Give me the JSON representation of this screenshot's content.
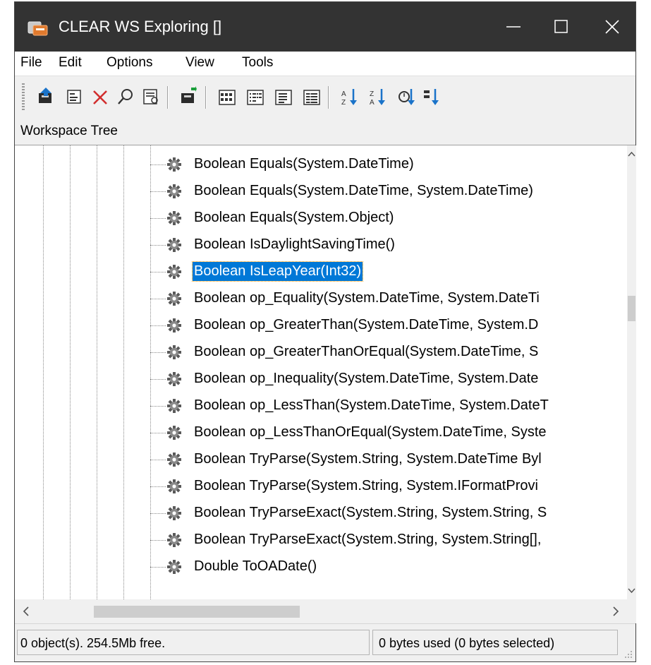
{
  "window": {
    "title": "CLEAR WS Exploring []",
    "controls": {
      "minimize": "minimize",
      "maximize": "maximize",
      "close": "close"
    }
  },
  "menu": [
    "File",
    "Edit",
    "Options",
    "View",
    "Tools"
  ],
  "toolbar": {
    "icons": [
      "up-folder-icon",
      "properties-icon",
      "delete-icon",
      "search-icon",
      "inspect-icon",
      "new-item-icon",
      "view-large-icons-icon",
      "view-small-icons-icon",
      "view-list-icon",
      "view-details-icon",
      "sort-az-icon",
      "sort-za-icon",
      "refresh-icon",
      "sort-size-icon"
    ]
  },
  "section": {
    "title": "Workspace Tree"
  },
  "tree": {
    "items": [
      "Boolean Equals(System.DateTime)",
      "Boolean Equals(System.DateTime, System.DateTime)",
      "Boolean Equals(System.Object)",
      "Boolean IsDaylightSavingTime()",
      "Boolean IsLeapYear(Int32)",
      "Boolean op_Equality(System.DateTime, System.DateTi",
      "Boolean op_GreaterThan(System.DateTime, System.D",
      "Boolean op_GreaterThanOrEqual(System.DateTime, S",
      "Boolean op_Inequality(System.DateTime, System.Date",
      "Boolean op_LessThan(System.DateTime, System.DateT",
      "Boolean op_LessThanOrEqual(System.DateTime, Syste",
      "Boolean TryParse(System.String, System.DateTime Byl",
      "Boolean TryParse(System.String, System.IFormatProvi",
      "Boolean TryParseExact(System.String, System.String, S",
      "Boolean TryParseExact(System.String, System.String[],",
      "Double ToOADate()"
    ],
    "selected_index": 4,
    "item_icon": "method-gear-icon"
  },
  "status": {
    "left": "0 object(s). 254.5Mb free.",
    "right": "0 bytes used (0 bytes selected)"
  },
  "colors": {
    "titlebar": "#333333",
    "selection": "#0078d7"
  }
}
